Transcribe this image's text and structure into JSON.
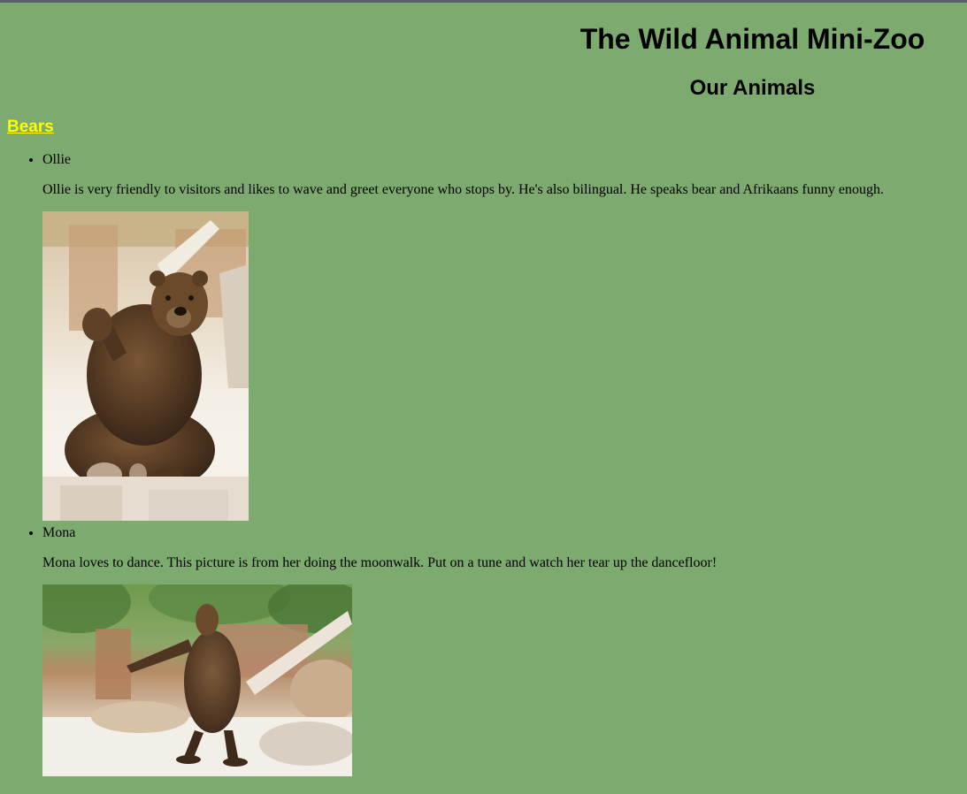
{
  "header": {
    "title": "The Wild Animal Mini-Zoo",
    "subtitle": "Our Animals"
  },
  "category": {
    "label": "Bears",
    "color": "#ffff00"
  },
  "animals": [
    {
      "name": "Ollie",
      "description": "Ollie is very friendly to visitors and likes to wave and greet everyone who stops by. He's also bilingual. He speaks bear and Afrikaans funny enough.",
      "image_alt": "Brown bear sitting and waving a paw"
    },
    {
      "name": "Mona",
      "description": "Mona loves to dance. This picture is from her doing the moonwalk. Put on a tune and watch her tear up the dancefloor!",
      "image_alt": "Brown bear standing on hind legs dancing"
    }
  ],
  "colors": {
    "page_background": "#7daa6e",
    "top_border": "#5a5f6a"
  }
}
